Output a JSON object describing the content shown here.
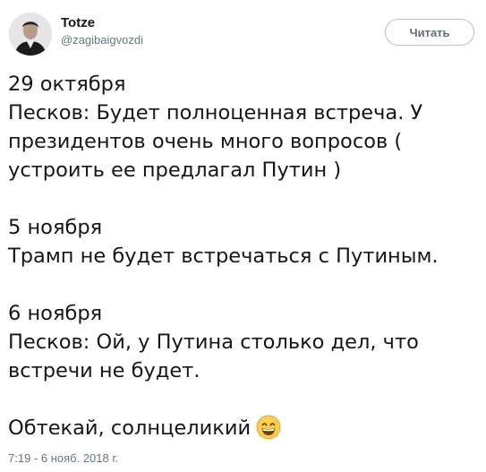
{
  "author": {
    "display_name": "Totze",
    "handle": "@zagibaigvozdi",
    "avatar_icon": "user-avatar-photo"
  },
  "follow_button": {
    "label": "Читать"
  },
  "tweet": {
    "paragraphs": [
      {
        "lines": [
          "29 октября",
          "Песков: Будет полноценная встреча. У",
          "президентов очень много вопросов (",
          "устроить ее предлагал Путин )"
        ]
      },
      {
        "lines": [
          "5 ноября",
          "Трамп не будет встречаться с Путиным."
        ]
      },
      {
        "lines": [
          "6 ноября",
          "Песков: Ой, у Путина столько дел, что",
          "встречи не будет."
        ]
      },
      {
        "lines": [
          "Обтекай, солнцеликий"
        ],
        "trailing_icon": "grinning-face-emoji"
      }
    ],
    "timestamp": "7:19 - 6 нояб. 2018 г."
  },
  "colors": {
    "text": "#14171a",
    "secondary": "#657786",
    "button_border": "#b8c1c9",
    "emoji_face": "#ffcc4d"
  }
}
